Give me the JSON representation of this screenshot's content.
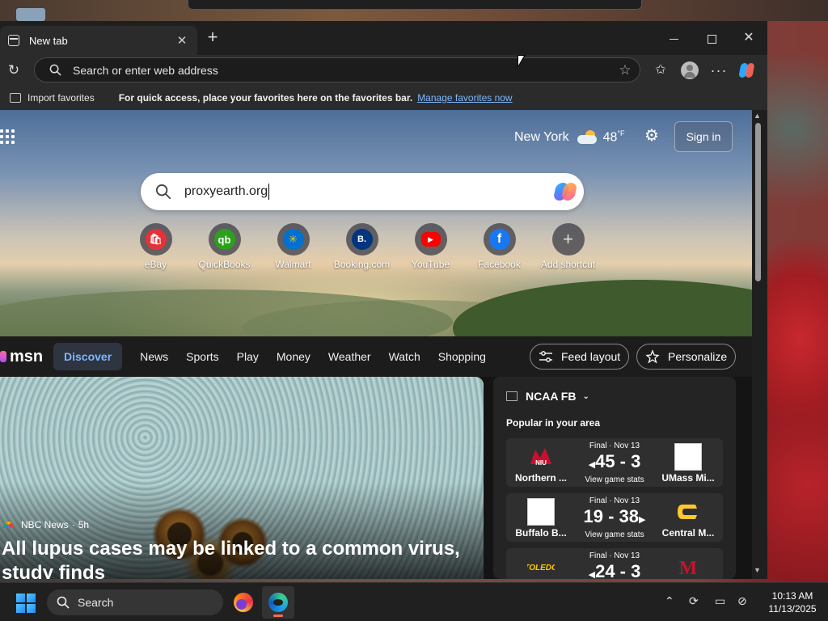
{
  "browser": {
    "tab_title": "New tab",
    "address_placeholder": "Search or enter web address",
    "favorites_bar": {
      "import_label": "Import favorites",
      "message": "For quick access, place your favorites here on the favorites bar.",
      "link": "Manage favorites now"
    }
  },
  "newtab": {
    "weather": {
      "city": "New York",
      "temp": "48",
      "unit": "°F"
    },
    "signin_label": "Sign in",
    "search_value": "proxyearth.org",
    "shortcuts": [
      {
        "label": "eBay",
        "color": "#e53238",
        "glyph": "🛍"
      },
      {
        "label": "QuickBooks",
        "color": "#2ca01c",
        "glyph": "qb"
      },
      {
        "label": "Walmart",
        "color": "#0071ce",
        "glyph": "✳"
      },
      {
        "label": "Booking.com",
        "color": "#003580",
        "glyph": "B."
      },
      {
        "label": "YouTube",
        "color": "#ff0000",
        "glyph": "▶"
      },
      {
        "label": "Facebook",
        "color": "#1877f2",
        "glyph": "f"
      },
      {
        "label": "Add shortcut",
        "color": "#777777",
        "glyph": "+"
      }
    ]
  },
  "msn": {
    "logo": "msn",
    "nav": [
      "Discover",
      "News",
      "Sports",
      "Play",
      "Money",
      "Weather",
      "Watch",
      "Shopping"
    ],
    "feed_layout": "Feed layout",
    "personalize": "Personalize",
    "story": {
      "source": "NBC News",
      "age": "5h",
      "headline": "All lupus cases may be linked to a common virus, study finds"
    },
    "sports": {
      "league": "NCAA FB",
      "subtitle": "Popular in your area",
      "games": [
        {
          "status": "Final · Nov 13",
          "home": "Northern ...",
          "away": "UMass Mi...",
          "score": "45 - 3",
          "link": "View game stats"
        },
        {
          "status": "Final · Nov 13",
          "home": "Buffalo B...",
          "away": "Central M...",
          "score": "19 - 38",
          "link": "View game stats"
        },
        {
          "status": "Final · Nov 13",
          "home": "",
          "away": "",
          "score": "24 - 3",
          "link": ""
        }
      ]
    }
  },
  "taskbar": {
    "search_label": "Search",
    "time": "10:13 AM",
    "date": "11/13/2025"
  }
}
